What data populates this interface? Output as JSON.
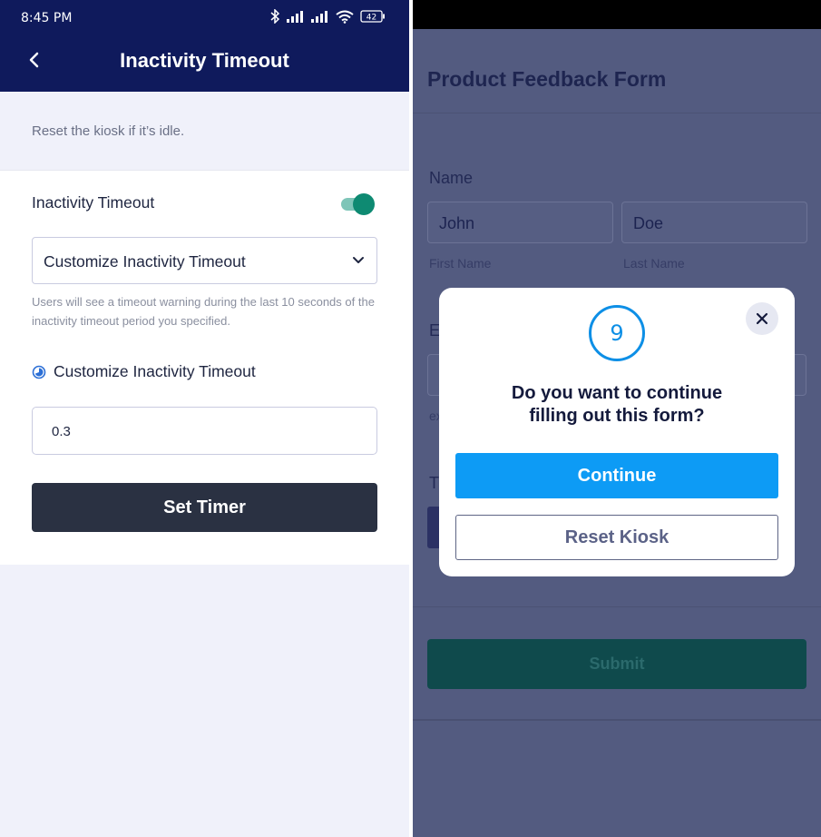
{
  "left_screen": {
    "status_bar": {
      "time": "8:45 PM",
      "battery": "42"
    },
    "header": {
      "title": "Inactivity Timeout"
    },
    "subtitle": "Reset the kiosk if it’s idle.",
    "toggle": {
      "label": "Inactivity Timeout",
      "enabled": true
    },
    "select": {
      "value": "Customize Inactivity Timeout"
    },
    "help_text": "Users will see a timeout warning during the last 10 seconds of the inactivity timeout period you specified.",
    "radio": {
      "label": "Customize Inactivity Timeout",
      "selected": true
    },
    "timeout_input": {
      "value": "0.3"
    },
    "set_timer_label": "Set Timer",
    "colors": {
      "header_bg": "#0f1a5c",
      "toggle_on": "#0e8a72",
      "button_bg": "#2a3142"
    }
  },
  "right_screen": {
    "form_title": "Product Feedback Form",
    "name_field": {
      "label": "Name",
      "first": {
        "value": "John",
        "caption": "First Name"
      },
      "last": {
        "value": "Doe",
        "caption": "Last Name"
      }
    },
    "partial": {
      "email_label": "E",
      "email_caption": "ex",
      "other_label": "T"
    },
    "submit_label": "Submit",
    "modal": {
      "countdown": "9",
      "question_line1": "Do you want to continue",
      "question_line2": "filling out this form?",
      "continue_label": "Continue",
      "reset_label": "Reset Kiosk",
      "close_icon": "close-icon"
    },
    "colors": {
      "overlay": "#535b80",
      "continue_bg": "#0d9bf5",
      "countdown": "#0d8fe6"
    }
  }
}
